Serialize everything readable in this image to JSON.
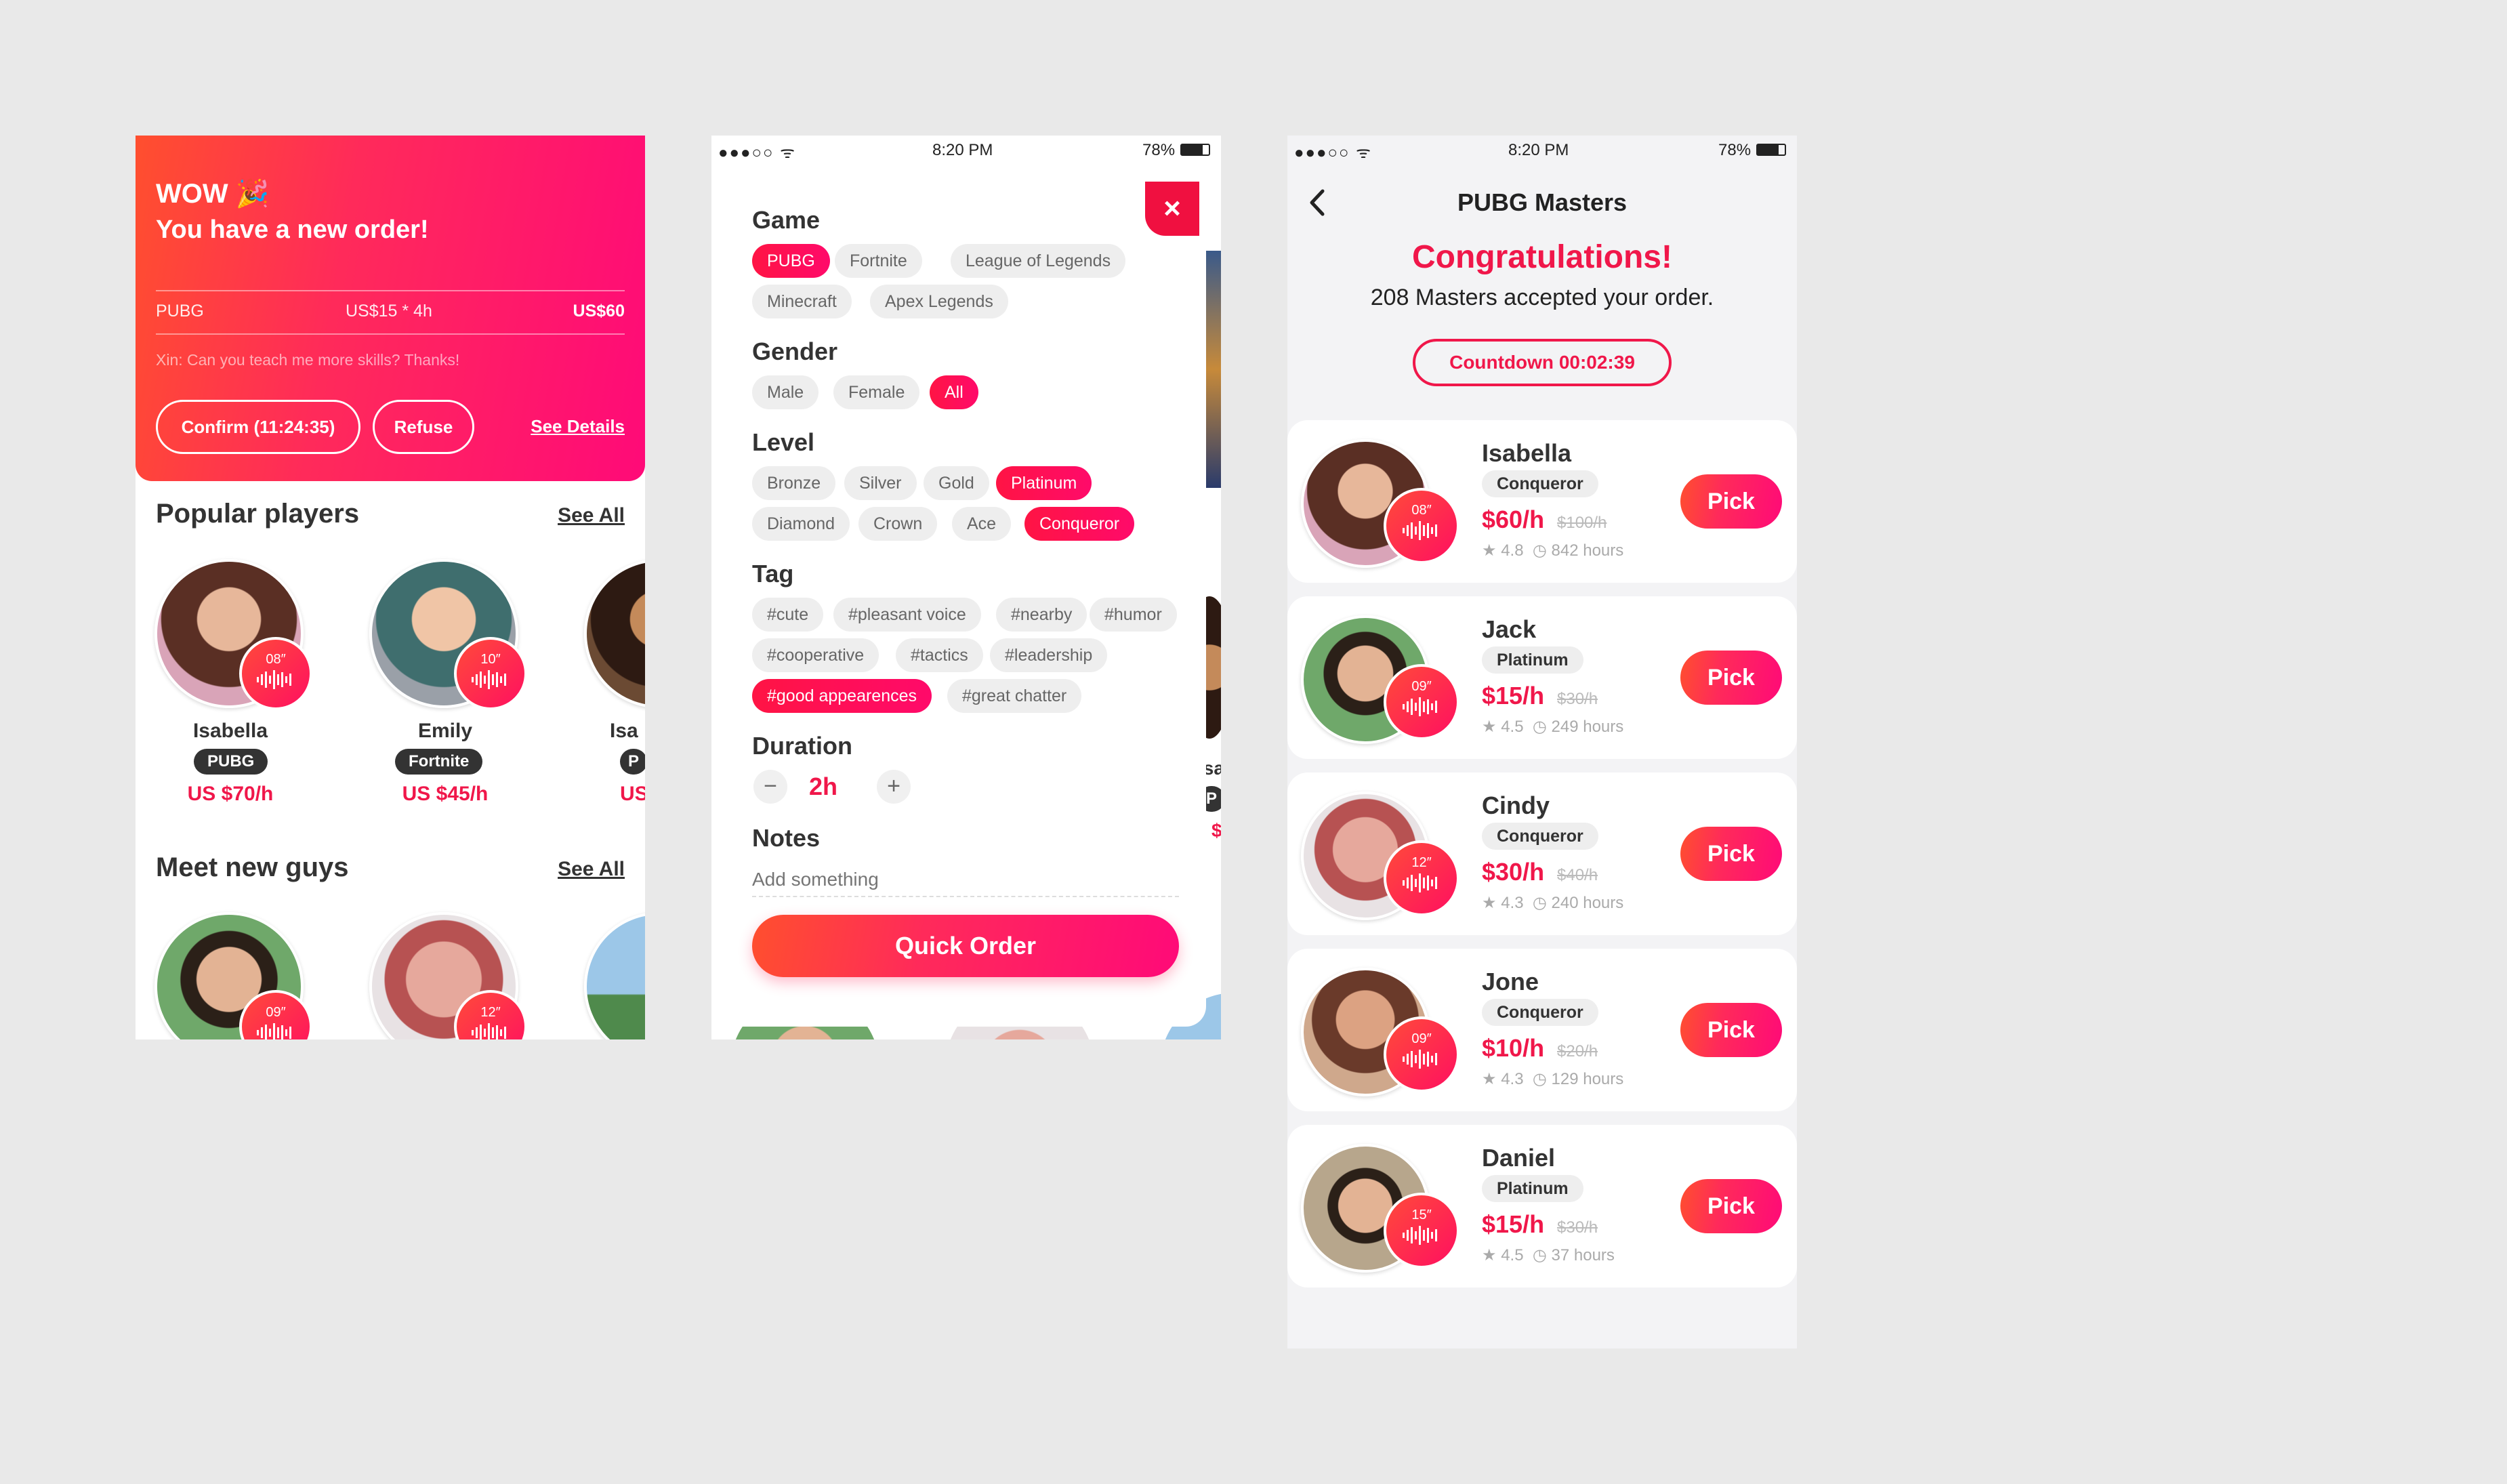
{
  "screen1": {
    "banner": {
      "wow": "WOW 🎉",
      "headline": "You have a new order!",
      "game": "PUBG",
      "rate": "US$15 * 4h",
      "total": "US$60",
      "message": "Xin: Can you teach me more skills? Thanks!",
      "confirm_label": "Confirm (11:24:35)",
      "refuse_label": "Refuse",
      "details_label": "See Details"
    },
    "popular": {
      "title": "Popular players",
      "see_all": "See All",
      "players": [
        {
          "name": "Isabella",
          "game": "PUBG",
          "price": "US $70/h",
          "voice": "08″"
        },
        {
          "name": "Emily",
          "game": "Fortnite",
          "price": "US $45/h",
          "voice": "10″"
        },
        {
          "name": "Isa",
          "game": "P",
          "price": "US"
        }
      ]
    },
    "meet": {
      "title": "Meet new guys",
      "see_all": "See All",
      "voices": [
        "09″",
        "12″"
      ]
    }
  },
  "screen2": {
    "status": {
      "time": "8:20 PM",
      "battery": "78%"
    },
    "close_icon": "×",
    "game_title": "Game",
    "games": [
      "PUBG",
      "Fortnite",
      "League of Legends",
      "Minecraft",
      "Apex Legends"
    ],
    "gender_title": "Gender",
    "genders": [
      "Male",
      "Female",
      "All"
    ],
    "level_title": "Level",
    "levels": [
      "Bronze",
      "Silver",
      "Gold",
      "Platinum",
      "Diamond",
      "Crown",
      "Ace",
      "Conqueror"
    ],
    "tag_title": "Tag",
    "tags": [
      "#cute",
      "#pleasant voice",
      "#nearby",
      "#humor",
      "#cooperative",
      "#tactics",
      "#leadership",
      "#good appearences",
      "#great chatter"
    ],
    "duration_title": "Duration",
    "duration_minus": "−",
    "duration_value": "2h",
    "duration_plus": "+",
    "notes_title": "Notes",
    "notes_placeholder": "Add something",
    "quick_order": "Quick Order",
    "peek_name": "Isa",
    "peek_game": "P",
    "peek_price": "$"
  },
  "screen3": {
    "status": {
      "time": "8:20 PM",
      "battery": "78%"
    },
    "title": "PUBG Masters",
    "congrats": "Congratulations!",
    "accepted": "208 Masters accepted your order.",
    "countdown": "Countdown 00:02:39",
    "pick_label": "Pick",
    "masters": [
      {
        "name": "Isabella",
        "level": "Conqueror",
        "price": "$60/h",
        "old": "$100/h",
        "rating": "4.8",
        "hours": "842 hours",
        "voice": "08″"
      },
      {
        "name": "Jack",
        "level": "Platinum",
        "price": "$15/h",
        "old": "$30/h",
        "rating": "4.5",
        "hours": "249 hours",
        "voice": "09″"
      },
      {
        "name": "Cindy",
        "level": "Conqueror",
        "price": "$30/h",
        "old": "$40/h",
        "rating": "4.3",
        "hours": "240 hours",
        "voice": "12″"
      },
      {
        "name": "Jone",
        "level": "Conqueror",
        "price": "$10/h",
        "old": "$20/h",
        "rating": "4.3",
        "hours": "129 hours",
        "voice": "09″"
      },
      {
        "name": "Daniel",
        "level": "Platinum",
        "price": "$15/h",
        "old": "$30/h",
        "rating": "4.5",
        "hours": "37 hours",
        "voice": "15″"
      }
    ]
  }
}
